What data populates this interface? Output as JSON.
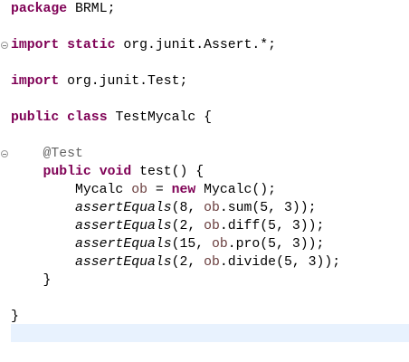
{
  "editor": {
    "lines": [
      [
        {
          "t": "package",
          "c": "kw"
        },
        {
          "t": " BRML;"
        }
      ],
      [],
      [
        {
          "t": "import",
          "c": "kw"
        },
        {
          "t": " "
        },
        {
          "t": "static",
          "c": "kw"
        },
        {
          "t": " org.junit.Assert.*;"
        }
      ],
      [],
      [
        {
          "t": "import",
          "c": "kw"
        },
        {
          "t": " org.junit.Test;"
        }
      ],
      [],
      [
        {
          "t": "public",
          "c": "kw"
        },
        {
          "t": " "
        },
        {
          "t": "class",
          "c": "kw"
        },
        {
          "t": " TestMycalc {"
        }
      ],
      [],
      [
        {
          "t": "    "
        },
        {
          "t": "@Test",
          "c": "ann"
        }
      ],
      [
        {
          "t": "    "
        },
        {
          "t": "public",
          "c": "kw"
        },
        {
          "t": " "
        },
        {
          "t": "void",
          "c": "kw"
        },
        {
          "t": " test() {"
        }
      ],
      [
        {
          "t": "        Mycalc "
        },
        {
          "t": "ob",
          "c": "var"
        },
        {
          "t": " = "
        },
        {
          "t": "new",
          "c": "kw"
        },
        {
          "t": " Mycalc();"
        }
      ],
      [
        {
          "t": "        "
        },
        {
          "t": "assertEquals",
          "c": "st"
        },
        {
          "t": "(8, "
        },
        {
          "t": "ob",
          "c": "var"
        },
        {
          "t": ".sum(5, 3));"
        }
      ],
      [
        {
          "t": "        "
        },
        {
          "t": "assertEquals",
          "c": "st"
        },
        {
          "t": "(2, "
        },
        {
          "t": "ob",
          "c": "var"
        },
        {
          "t": ".diff(5, 3));"
        }
      ],
      [
        {
          "t": "        "
        },
        {
          "t": "assertEquals",
          "c": "st"
        },
        {
          "t": "(15, "
        },
        {
          "t": "ob",
          "c": "var"
        },
        {
          "t": ".pro(5, 3));"
        }
      ],
      [
        {
          "t": "        "
        },
        {
          "t": "assertEquals",
          "c": "st"
        },
        {
          "t": "(2, "
        },
        {
          "t": "ob",
          "c": "var"
        },
        {
          "t": ".divide(5, 3));"
        }
      ],
      [
        {
          "t": "    }"
        }
      ],
      [],
      [
        {
          "t": "}"
        }
      ],
      []
    ],
    "fold_lines": [
      2,
      8
    ],
    "current_line": 18
  },
  "colors": {
    "keyword": "#7f0055",
    "annotation": "#646464",
    "local_variable": "#6a3e3e",
    "current_line": "#e8f2fe"
  }
}
